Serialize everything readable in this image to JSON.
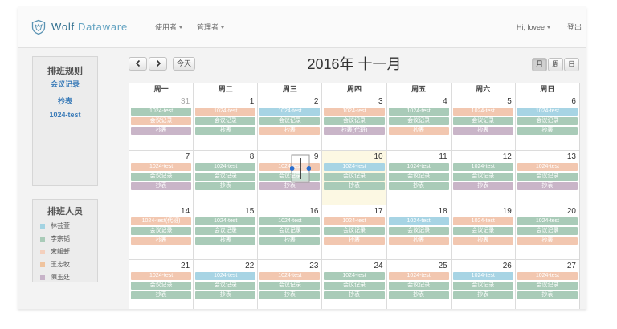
{
  "header": {
    "logo_icon": "wolf-shield-icon",
    "brand_name_primary": "Wolf",
    "brand_name_secondary": "Dataware",
    "menus": [
      {
        "label": "使用者",
        "icon": "chevron-down-icon"
      },
      {
        "label": "管理者",
        "icon": "chevron-down-icon"
      }
    ],
    "user_menu": {
      "label": "Hi, lovee",
      "icon": "chevron-down-icon"
    },
    "logout_label": "登出"
  },
  "rules_panel": {
    "title": "排班规则",
    "items": [
      "会议记录",
      "抄表",
      "1024-test"
    ]
  },
  "staff_panel": {
    "title": "排班人员",
    "items": [
      {
        "name": "林芸萱",
        "color": "#a3d3e2"
      },
      {
        "name": "李宗韬",
        "color": "#a9cbb8"
      },
      {
        "name": "宋韻軒",
        "color": "#f4d0bd"
      },
      {
        "name": "王志牧",
        "color": "#efc39e"
      },
      {
        "name": "陳玉廷",
        "color": "#c7b3c8"
      }
    ]
  },
  "calendar": {
    "prev_icon": "chevron-left-icon",
    "next_icon": "chevron-right-icon",
    "today_label": "今天",
    "title": "2016年 十一月",
    "views": [
      "月",
      "周",
      "日"
    ],
    "active_view": "月",
    "weekdays": [
      "周一",
      "周二",
      "周三",
      "周四",
      "周五",
      "周六",
      "周日"
    ],
    "weeks": [
      {
        "days": [
          {
            "day": 31,
            "other_month": true,
            "events": [
              {
                "label": "1024-test",
                "color": "#a9cbb8"
              },
              {
                "label": "会议记录",
                "color": "#f2c7b0"
              },
              {
                "label": "抄表",
                "color": "#c9b5c8"
              }
            ]
          },
          {
            "day": 1,
            "events": [
              {
                "label": "1024-test",
                "color": "#f2c7b0"
              },
              {
                "label": "会议记录",
                "color": "#a9cbb8"
              },
              {
                "label": "抄表",
                "color": "#a9cbb8"
              }
            ]
          },
          {
            "day": 2,
            "events": [
              {
                "label": "1024-test",
                "color": "#a7d4e4"
              },
              {
                "label": "会议记录",
                "color": "#a9cbb8"
              },
              {
                "label": "抄表",
                "color": "#f2c7b0"
              }
            ]
          },
          {
            "day": 3,
            "events": [
              {
                "label": "1024-test",
                "color": "#f2c7b0"
              },
              {
                "label": "会议记录",
                "color": "#a9cbb8"
              },
              {
                "label": "抄表(代班)",
                "color": "#c9b5c8"
              }
            ]
          },
          {
            "day": 4,
            "events": [
              {
                "label": "1024-test",
                "color": "#a9cbb8"
              },
              {
                "label": "会议记录",
                "color": "#a9cbb8"
              },
              {
                "label": "抄表",
                "color": "#f2c7b0"
              }
            ]
          },
          {
            "day": 5,
            "events": [
              {
                "label": "1024-test",
                "color": "#f2c7b0"
              },
              {
                "label": "会议记录",
                "color": "#a9cbb8"
              },
              {
                "label": "抄表",
                "color": "#c9b5c8"
              }
            ]
          },
          {
            "day": 6,
            "events": [
              {
                "label": "1024-test",
                "color": "#a7d4e4"
              },
              {
                "label": "会议记录",
                "color": "#a9cbb8"
              },
              {
                "label": "抄表",
                "color": "#a9cbb8"
              }
            ]
          }
        ]
      },
      {
        "days": [
          {
            "day": 7,
            "events": [
              {
                "label": "1024-test",
                "color": "#f2c7b0"
              },
              {
                "label": "会议记录",
                "color": "#a9cbb8"
              },
              {
                "label": "抄表",
                "color": "#c9b5c8"
              }
            ]
          },
          {
            "day": 8,
            "events": [
              {
                "label": "1024-test",
                "color": "#a9cbb8"
              },
              {
                "label": "会议记录",
                "color": "#a9cbb8"
              },
              {
                "label": "抄表",
                "color": "#a9cbb8"
              }
            ]
          },
          {
            "day": 9,
            "events": [
              {
                "label": "1024-test",
                "color": "#f2c7b0"
              },
              {
                "label": "会议记录",
                "color": "#a9cbb8"
              },
              {
                "label": "抄表",
                "color": "#c9b5c8"
              }
            ]
          },
          {
            "day": 10,
            "today": true,
            "events": [
              {
                "label": "1024-test",
                "color": "#a7d4e4"
              },
              {
                "label": "会议记录",
                "color": "#a9cbb8"
              },
              {
                "label": "抄表",
                "color": "#a9cbb8"
              }
            ]
          },
          {
            "day": 11,
            "events": [
              {
                "label": "1024-test",
                "color": "#a9cbb8"
              },
              {
                "label": "会议记录",
                "color": "#a9cbb8"
              },
              {
                "label": "抄表",
                "color": "#a9cbb8"
              }
            ]
          },
          {
            "day": 12,
            "events": [
              {
                "label": "1024-test",
                "color": "#a9cbb8"
              },
              {
                "label": "会议记录",
                "color": "#a9cbb8"
              },
              {
                "label": "抄表",
                "color": "#c9b5c8"
              }
            ]
          },
          {
            "day": 13,
            "events": [
              {
                "label": "1024-test",
                "color": "#f2c7b0"
              },
              {
                "label": "会议记录",
                "color": "#a9cbb8"
              },
              {
                "label": "抄表",
                "color": "#c9b5c8"
              }
            ]
          }
        ]
      },
      {
        "days": [
          {
            "day": 14,
            "events": [
              {
                "label": "1024-test(代班)",
                "color": "#f2c7b0"
              },
              {
                "label": "会议记录",
                "color": "#a9cbb8"
              },
              {
                "label": "抄表",
                "color": "#f2c7b0"
              }
            ]
          },
          {
            "day": 15,
            "events": [
              {
                "label": "1024-test",
                "color": "#a9cbb8"
              },
              {
                "label": "会议记录",
                "color": "#a9cbb8"
              },
              {
                "label": "抄表",
                "color": "#a9cbb8"
              }
            ]
          },
          {
            "day": 16,
            "events": [
              {
                "label": "1024-test",
                "color": "#a9cbb8"
              },
              {
                "label": "会议记录",
                "color": "#a9cbb8"
              },
              {
                "label": "抄表",
                "color": "#a9cbb8"
              }
            ]
          },
          {
            "day": 17,
            "events": [
              {
                "label": "1024-test",
                "color": "#f2c7b0"
              },
              {
                "label": "会议记录",
                "color": "#a9cbb8"
              },
              {
                "label": "抄表",
                "color": "#f2c7b0"
              }
            ]
          },
          {
            "day": 18,
            "events": [
              {
                "label": "1024-test",
                "color": "#a7d4e4"
              },
              {
                "label": "会议记录",
                "color": "#a9cbb8"
              },
              {
                "label": "抄表",
                "color": "#f2c7b0"
              }
            ]
          },
          {
            "day": 19,
            "events": [
              {
                "label": "1024-test",
                "color": "#f2c7b0"
              },
              {
                "label": "会议记录",
                "color": "#a9cbb8"
              },
              {
                "label": "抄表",
                "color": "#f2c7b0"
              }
            ]
          },
          {
            "day": 20,
            "events": [
              {
                "label": "1024-test",
                "color": "#a9cbb8"
              },
              {
                "label": "会议记录",
                "color": "#a9cbb8"
              },
              {
                "label": "抄表",
                "color": "#f2c7b0"
              }
            ]
          }
        ]
      },
      {
        "days": [
          {
            "day": 21,
            "events": [
              {
                "label": "1024-test",
                "color": "#f2c7b0"
              },
              {
                "label": "会议记录",
                "color": "#a9cbb8"
              },
              {
                "label": "抄表",
                "color": "#a9cbb8"
              }
            ]
          },
          {
            "day": 22,
            "events": [
              {
                "label": "1024-test",
                "color": "#a7d4e4"
              },
              {
                "label": "会议记录",
                "color": "#a9cbb8"
              },
              {
                "label": "抄表",
                "color": "#a9cbb8"
              }
            ]
          },
          {
            "day": 23,
            "events": [
              {
                "label": "1024-test",
                "color": "#f2c7b0"
              },
              {
                "label": "会议记录",
                "color": "#a9cbb8"
              },
              {
                "label": "抄表",
                "color": "#a9cbb8"
              }
            ]
          },
          {
            "day": 24,
            "events": [
              {
                "label": "1024-test",
                "color": "#a9cbb8"
              },
              {
                "label": "会议记录",
                "color": "#a9cbb8"
              },
              {
                "label": "抄表",
                "color": "#a9cbb8"
              }
            ]
          },
          {
            "day": 25,
            "events": [
              {
                "label": "1024-test",
                "color": "#f2c7b0"
              },
              {
                "label": "会议记录",
                "color": "#a9cbb8"
              },
              {
                "label": "抄表",
                "color": "#a9cbb8"
              }
            ]
          },
          {
            "day": 26,
            "events": [
              {
                "label": "1024-test",
                "color": "#a7d4e4"
              },
              {
                "label": "会议记录",
                "color": "#a9cbb8"
              },
              {
                "label": "抄表",
                "color": "#a9cbb8"
              }
            ]
          },
          {
            "day": 27,
            "events": [
              {
                "label": "1024-test",
                "color": "#f2c7b0"
              },
              {
                "label": "会议记录",
                "color": "#a9cbb8"
              },
              {
                "label": "抄表",
                "color": "#a9cbb8"
              }
            ]
          }
        ]
      }
    ]
  },
  "colors": {
    "link_blue": "#3a7bb8",
    "today_bg": "#fcf8e3",
    "drag_handle": "#2a6fd0"
  }
}
